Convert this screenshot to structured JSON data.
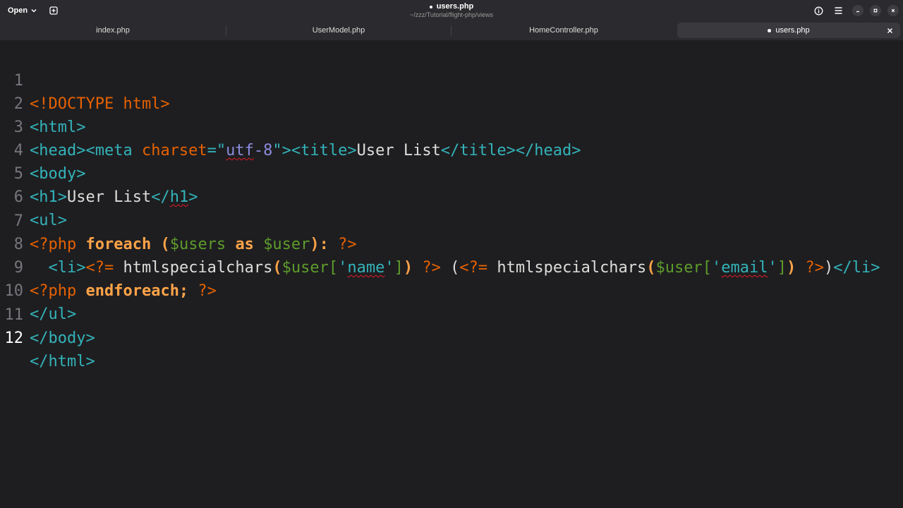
{
  "header": {
    "open_label": "Open",
    "title": "users.php",
    "subtitle": "~/zzz/Tutorial/flight-php/views"
  },
  "tabs": [
    {
      "label": "index.php",
      "active": false
    },
    {
      "label": "UserModel.php",
      "active": false
    },
    {
      "label": "HomeController.php",
      "active": false
    },
    {
      "label": "users.php",
      "active": true,
      "modified": true
    }
  ],
  "editor": {
    "current_line": 12,
    "lines": [
      {
        "n": "1"
      },
      {
        "n": "2"
      },
      {
        "n": "3"
      },
      {
        "n": "4"
      },
      {
        "n": "5"
      },
      {
        "n": "6"
      },
      {
        "n": "7"
      },
      {
        "n": "8"
      },
      {
        "n": "9"
      },
      {
        "n": "10"
      },
      {
        "n": "11"
      },
      {
        "n": "12"
      }
    ],
    "tokens": {
      "l1": [
        "<!DOCTYPE html>"
      ],
      "l2": [
        "<html>"
      ],
      "l3": [
        "<head><meta ",
        "charset",
        "=\"",
        "utf",
        "-8",
        "\"",
        "><title>",
        "User List",
        "</title></head>"
      ],
      "l4": [
        "<body>"
      ],
      "l5": [
        "<h1>",
        "User List",
        "</",
        "h1",
        ">"
      ],
      "l6": [
        "<ul>"
      ],
      "l7": [
        "<?php ",
        "foreach",
        " (",
        "$users",
        " ",
        "as",
        " ",
        "$user",
        "):",
        " ?>"
      ],
      "l8": [
        "  <li>",
        "<?=",
        " htmlspecialchars",
        "(",
        "$user",
        "[",
        "'",
        "name",
        "'",
        "]",
        ")",
        " ?>",
        " (",
        "<?=",
        " htmlspecialchars",
        "(",
        "$user",
        "[",
        "'",
        "email",
        "'",
        "]",
        ")",
        " ?>",
        ")",
        "</li>"
      ],
      "l9": [
        "<?php ",
        "endforeach;",
        " ?>"
      ],
      "l10": [
        "</ul>"
      ],
      "l11": [
        "</body>"
      ],
      "l12": [
        "</html>"
      ]
    }
  },
  "colors": {
    "background": "#1e1e21",
    "headerbar": "#2b2b2f",
    "tag": "#33b3b8",
    "php_delim": "#e66100",
    "php_keyword": "#ffa348",
    "variable": "#5e9c2a",
    "string_attr": "#8c8cde"
  },
  "icons": {
    "new_tab": "new-tab-icon",
    "info": "info-icon",
    "menu": "hamburger-menu-icon",
    "minimize": "minimize-icon",
    "maximize": "maximize-icon",
    "close": "close-icon"
  }
}
